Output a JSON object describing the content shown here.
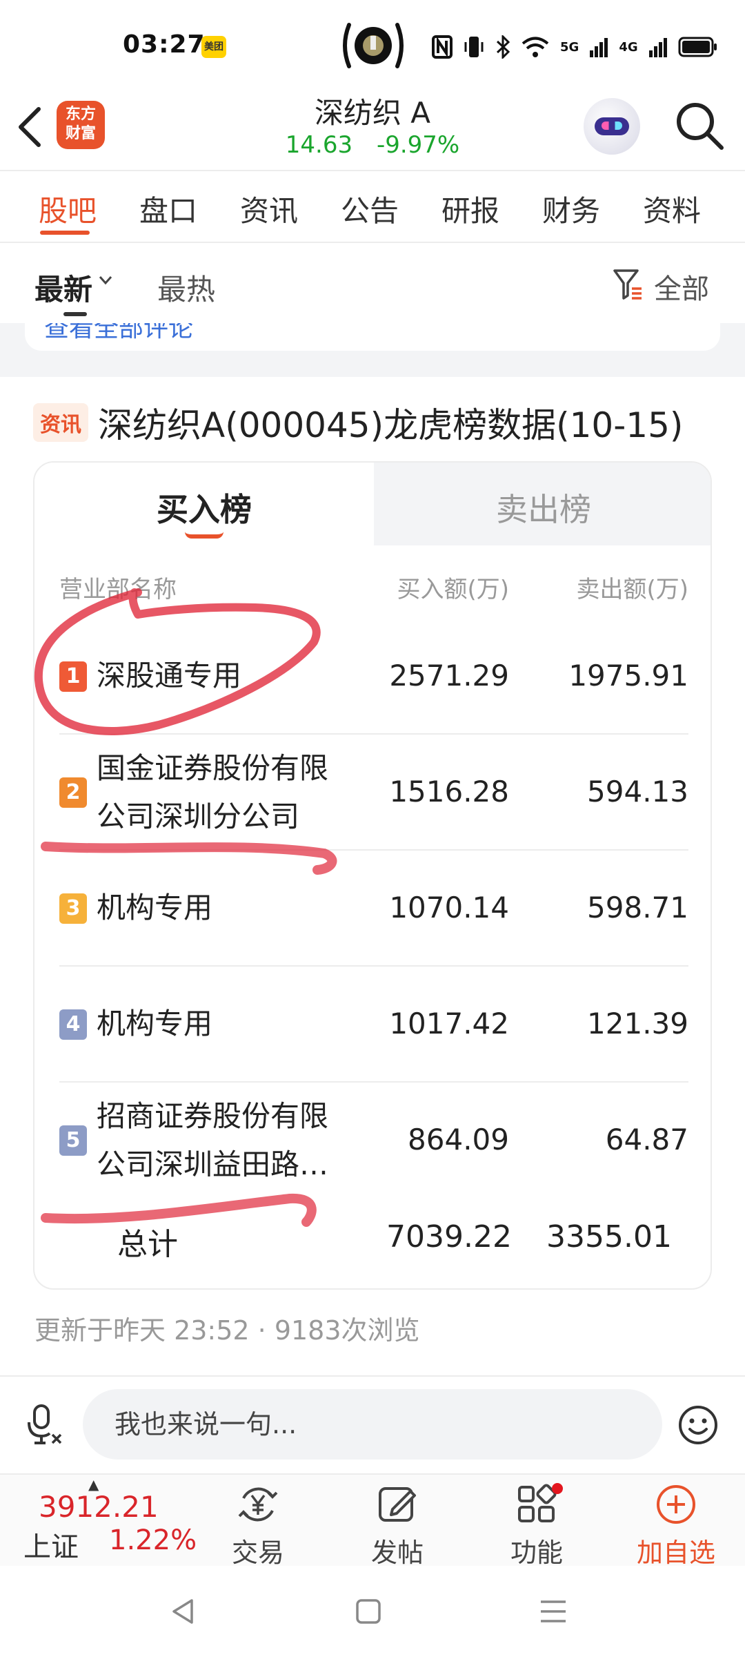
{
  "status_bar": {
    "time": "03:27",
    "app_badge": "美团",
    "network_labels": [
      "5G",
      "4G"
    ]
  },
  "header": {
    "logo_text_line1": "东方",
    "logo_text_line2": "财富",
    "stock_name": "深纺织 A",
    "price": "14.63",
    "change_pct": "-9.97%",
    "colors": {
      "down": "#1aa52d",
      "brand": "#e8522b"
    }
  },
  "tabs": [
    {
      "label": "股吧",
      "active": true
    },
    {
      "label": "盘口"
    },
    {
      "label": "资讯"
    },
    {
      "label": "公告"
    },
    {
      "label": "研报"
    },
    {
      "label": "财务"
    },
    {
      "label": "资料"
    }
  ],
  "sort": {
    "latest": "最新",
    "hot": "最热",
    "filter": "全部"
  },
  "previous_card": {
    "link_text": "查看全部评论"
  },
  "post": {
    "tag": "资讯",
    "title": "深纺织A(000045)龙虎榜数据(10-15)",
    "lhb": {
      "tab_buy": "买入榜",
      "tab_sell": "卖出榜",
      "columns": {
        "name": "营业部名称",
        "buy": "买入额(万)",
        "sell": "卖出额(万)"
      },
      "rows": [
        {
          "rank": "1",
          "name": "深股通专用",
          "buy": "2571.29",
          "sell": "1975.91",
          "rank_color": "#ef5a36"
        },
        {
          "rank": "2",
          "name": "国金证券股份有限公司深圳分公司",
          "buy": "1516.28",
          "sell": "594.13",
          "rank_color": "#f08a2e"
        },
        {
          "rank": "3",
          "name": "机构专用",
          "buy": "1070.14",
          "sell": "598.71",
          "rank_color": "#f6b13a"
        },
        {
          "rank": "4",
          "name": "机构专用",
          "buy": "1017.42",
          "sell": "121.39",
          "rank_color": "#8d9cc6"
        },
        {
          "rank": "5",
          "name": "招商证券股份有限公司深圳益田路…",
          "buy": "864.09",
          "sell": "64.87",
          "rank_color": "#8d9cc6"
        }
      ],
      "total": {
        "label": "总计",
        "buy": "7039.22",
        "sell": "3355.01"
      }
    },
    "meta": "更新于昨天 23:52 · 9183次浏览"
  },
  "comment_bar": {
    "placeholder": "我也来说一句..."
  },
  "bottom_nav": {
    "index_value": "3912.21",
    "index_name": "上证",
    "index_pct": "1.22%",
    "items": [
      {
        "label": "交易",
        "icon": "trade-yen-icon"
      },
      {
        "label": "发帖",
        "icon": "post-edit-icon"
      },
      {
        "label": "功能",
        "icon": "function-grid-icon"
      },
      {
        "label": "加自选",
        "icon": "add-watchlist-icon"
      }
    ]
  }
}
